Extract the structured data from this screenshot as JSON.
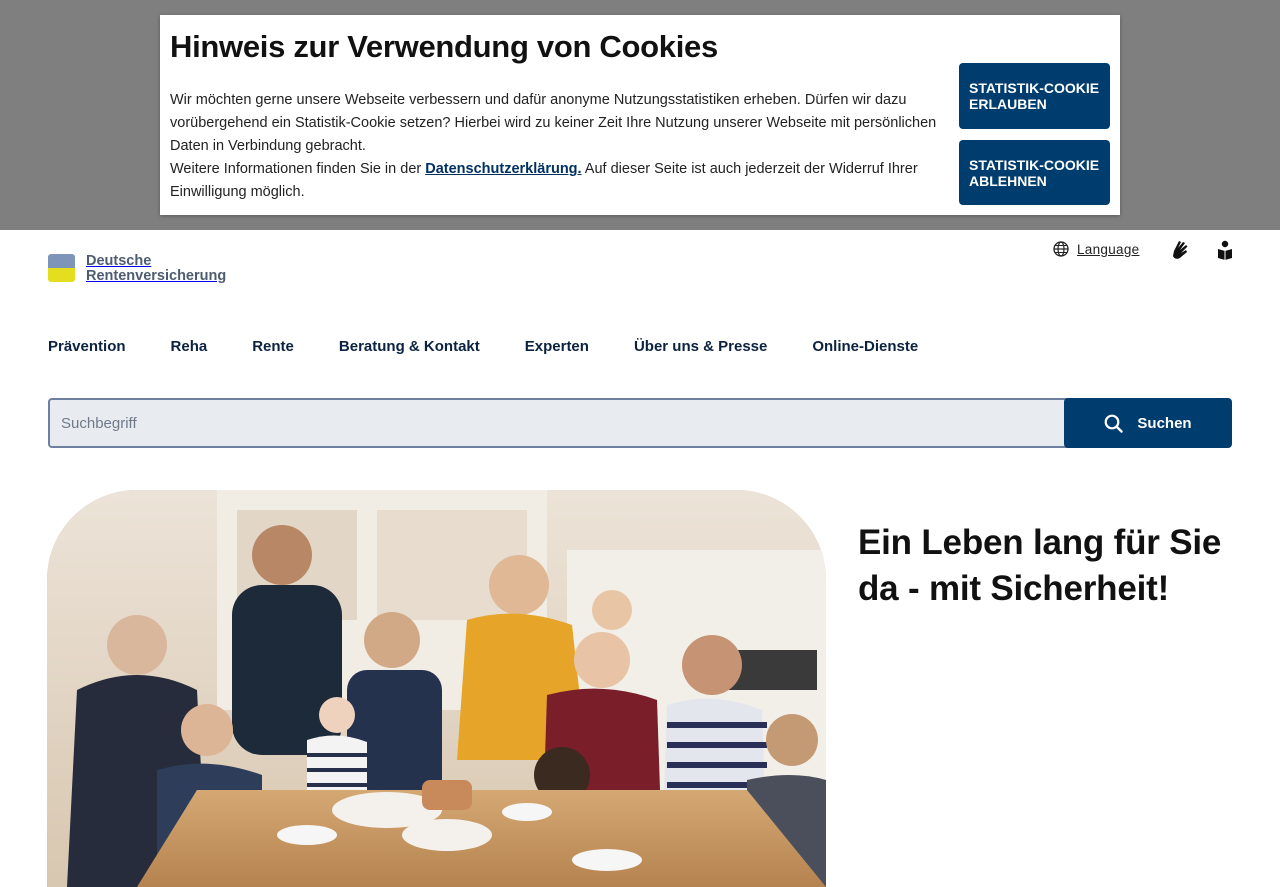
{
  "cookie": {
    "title": "Hinweis zur Verwendung von Cookies",
    "text1": "Wir möchten gerne unsere Webseite verbessern und dafür anonyme Nutzungsstatistiken erheben. Dürfen wir dazu vorübergehend ein Statistik-Cookie setzen? Hierbei wird zu keiner Zeit Ihre Nutzung unserer Webseite mit persönlichen Daten in Verbindung gebracht.",
    "text2_before": "Weitere Informationen finden Sie in der ",
    "privacy_link": "Datenschutzerklärung.",
    "text2_after": " Auf dieser Seite ist auch jederzeit der Widerruf Ihrer Einwilligung möglich.",
    "allow_label": "Statistik-Cookie erlauben",
    "deny_label": "Statistik-Cookie ablehnen"
  },
  "header": {
    "logo_line1": "Deutsche",
    "logo_line2": "Rentenversicherung",
    "language_label": "Language"
  },
  "nav": {
    "items": [
      "Prävention",
      "Reha",
      "Rente",
      "Beratung & Kontakt",
      "Experten",
      "Über uns & Presse",
      "Online-Dienste"
    ]
  },
  "search": {
    "placeholder": "Suchbegriff",
    "button_label": "Suchen"
  },
  "hero": {
    "title": "Ein Leben lang für Sie da - mit Sicherheit!"
  },
  "colors": {
    "primary": "#003d6f",
    "accent": "#d4dc2a",
    "overlay": "#7f7f7f",
    "logo_blue": "#7e94b8",
    "logo_yellow": "#e4de1e"
  }
}
